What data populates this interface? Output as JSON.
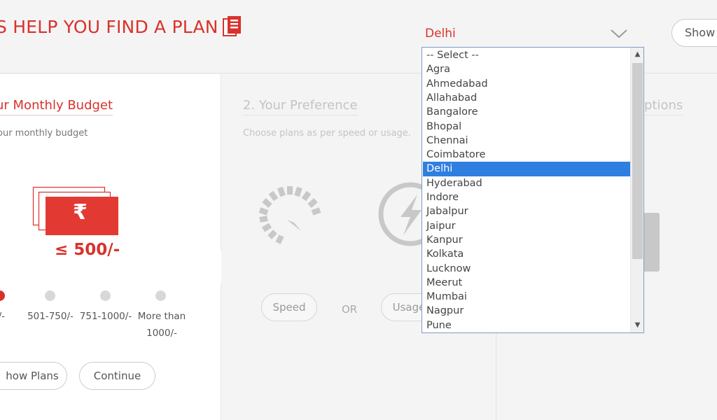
{
  "header": {
    "title": "S HELP YOU FIND A PLAN",
    "city_select": {
      "value": "Delhi"
    },
    "show_button": "Show"
  },
  "budget": {
    "step_title": "ur Monthly Budget",
    "subtitle": "our monthly budget",
    "currency_symbol": "₹",
    "selected_value": "≤ 500/-",
    "ranges": [
      "0/-",
      "501-750/-",
      "751-1000/-",
      "More than\n1000/-"
    ],
    "show_plans_label": "how Plans",
    "continue_label": "Continue"
  },
  "preference": {
    "step_title": "2. Your Preference",
    "subtitle": "Choose plans as per speed or usage.",
    "speed_label": "Speed",
    "or_label": "OR",
    "usage_label": "Usage"
  },
  "options": {
    "step_title": "ptions"
  },
  "city_dropdown": {
    "options": [
      "-- Select --",
      "Agra",
      "Ahmedabad",
      "Allahabad",
      "Bangalore",
      "Bhopal",
      "Chennai",
      "Coimbatore",
      "Delhi",
      "Hyderabad",
      "Indore",
      "Jabalpur",
      "Jaipur",
      "Kanpur",
      "Kolkata",
      "Lucknow",
      "Meerut",
      "Mumbai",
      "Nagpur",
      "Pune"
    ],
    "selected_index": 8
  },
  "colors": {
    "accent": "#d9322c",
    "selection": "#2f7fe0"
  }
}
